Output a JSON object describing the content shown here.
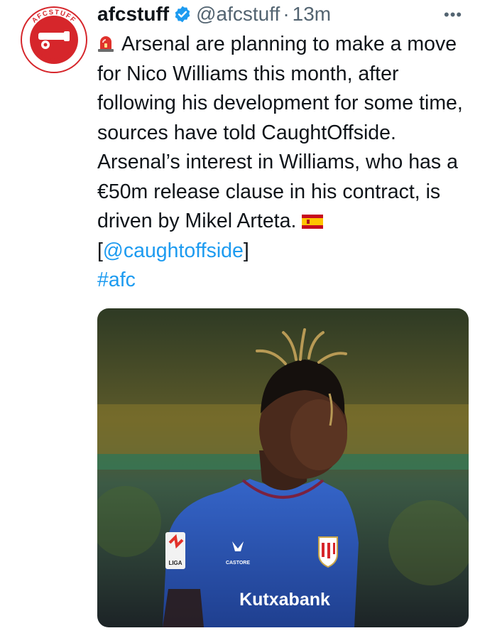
{
  "account": {
    "avatar_ring_text": "AFCSTUFF",
    "display_name": "afcstuff",
    "handle": "@afcstuff",
    "separator": "·",
    "timestamp": "13m",
    "more_label": "•••"
  },
  "tweet": {
    "text_before_flag": "Arsenal are planning to make a move for Nico Williams this month, after following his development for some time, sources have told CaughtOffside. Arsenal’s interest in Williams, who has a €50m release clause in his contract, is driven by Mikel Arteta.",
    "source_open": "[",
    "source_mention": "@caughtoffside",
    "source_close": "]",
    "hashtag": "#afc",
    "icons": [
      "siren-icon",
      "spain-flag-icon"
    ]
  },
  "media": {
    "sleeve_badge": "LIGA",
    "kit_maker": "CASTORE",
    "sponsor": "Kutxabank"
  },
  "colors": {
    "link": "#1d9bf0",
    "verified": "#1d9bf0",
    "avatar_red": "#d6262b",
    "kit_blue": "#2a56b8"
  }
}
